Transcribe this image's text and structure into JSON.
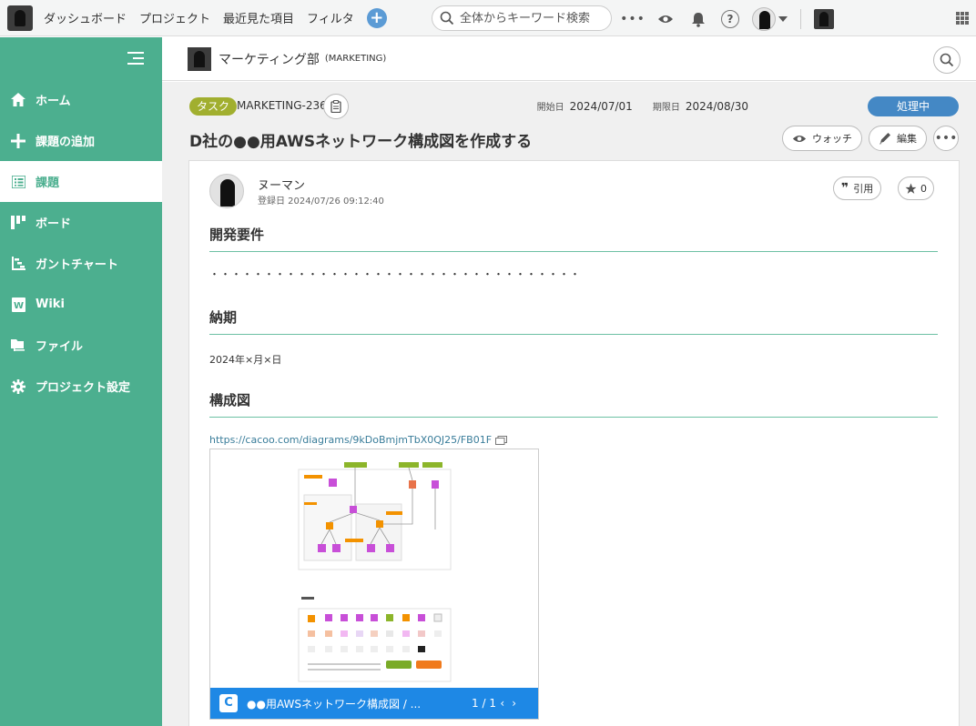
{
  "topbar": {
    "nav": [
      "ダッシュボード",
      "プロジェクト",
      "最近見た項目",
      "フィルタ"
    ],
    "search_placeholder": "全体からキーワード検索"
  },
  "sidebar": {
    "items": [
      {
        "label": "ホーム",
        "icon": "home-icon"
      },
      {
        "label": "課題の追加",
        "icon": "plus-icon"
      },
      {
        "label": "課題",
        "icon": "list-icon",
        "active": true
      },
      {
        "label": "ボード",
        "icon": "board-icon"
      },
      {
        "label": "ガントチャート",
        "icon": "gantt-icon"
      },
      {
        "label": "Wiki",
        "icon": "wiki-icon"
      },
      {
        "label": "ファイル",
        "icon": "folder-icon"
      },
      {
        "label": "プロジェクト設定",
        "icon": "gear-icon"
      }
    ]
  },
  "project": {
    "name": "マーケティング部",
    "key": "(MARKETING)"
  },
  "issue": {
    "type": "タスク",
    "key": "MARKETING-236",
    "start_label": "開始日",
    "start_date": "2024/07/01",
    "due_label": "期限日",
    "due_date": "2024/08/30",
    "status": "処理中",
    "title": "D社の●●用AWSネットワーク構成図を作成する",
    "watch_label": "ウォッチ",
    "edit_label": "編集"
  },
  "card": {
    "author": "ヌーマン",
    "date": "登録日 2024/07/26 09:12:40",
    "quote_label": "引用",
    "star_count": "0",
    "sections": [
      {
        "heading": "開発要件",
        "text": "・・・・・・・・・・・・・・・・・・・・・・・・・・・・・・・・・・"
      },
      {
        "heading": "納期",
        "text": "2024年×月×日"
      },
      {
        "heading": "構成図",
        "text": ""
      }
    ],
    "link": "https://cacoo.com/diagrams/9kDoBmjmTbX0QJ25/FB01F",
    "embed": {
      "logo": "C",
      "title": "●●用AWSネットワーク構成図 / ...",
      "page": "1 / 1"
    }
  },
  "colors": {
    "sidebar": "#4caf8f",
    "status": "#4488c5",
    "issue_type": "#a1af2f",
    "embed_bar": "#1e88e5"
  }
}
